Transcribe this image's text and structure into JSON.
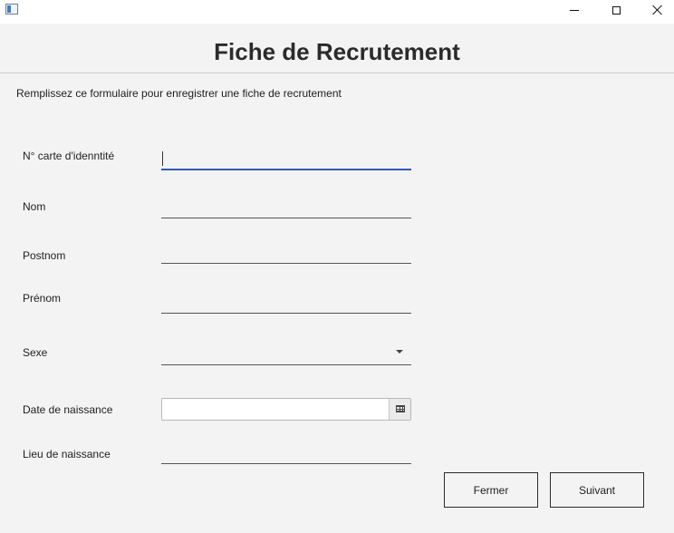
{
  "window": {
    "icon": "app-window-icon",
    "controls": [
      "minimize-icon",
      "maximize-icon",
      "close-icon"
    ]
  },
  "header": {
    "title": "Fiche de Recrutement"
  },
  "form": {
    "instruction": "Remplissez ce formulaire pour enregistrer une fiche de recrutement",
    "fields": {
      "id_card": {
        "label": "N° carte d'idenntité",
        "value": ""
      },
      "nom": {
        "label": "Nom",
        "value": ""
      },
      "postnom": {
        "label": "Postnom",
        "value": ""
      },
      "prenom": {
        "label": "Prénom",
        "value": ""
      },
      "sexe": {
        "label": "Sexe",
        "value": ""
      },
      "date_naissance": {
        "label": "Date de naissance",
        "value": ""
      },
      "lieu_naissance": {
        "label": "Lieu de naissance",
        "value": ""
      }
    }
  },
  "buttons": {
    "close_label": "Fermer",
    "next_label": "Suivant"
  },
  "colors": {
    "background": "#f3f3f3",
    "focus_underline": "#3555b5",
    "title_text": "#2b2b2b"
  }
}
